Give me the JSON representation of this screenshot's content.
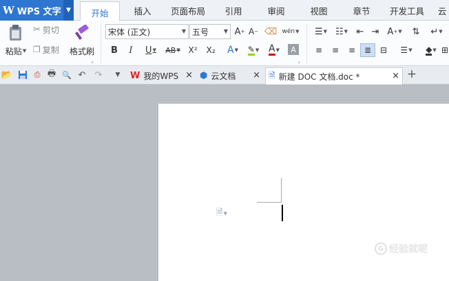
{
  "app": {
    "name": "WPS 文字",
    "logo": "W"
  },
  "menu_tabs": [
    "开始",
    "插入",
    "页面布局",
    "引用",
    "审阅",
    "视图",
    "章节",
    "开发工具",
    "云"
  ],
  "active_tab": "开始",
  "ribbon": {
    "paste_label": "粘贴",
    "cut_label": "剪切",
    "copy_label": "复制",
    "format_painter_label": "格式刷",
    "font_name": "宋体 (正文)",
    "font_size": "五号",
    "bold": "B",
    "italic": "I",
    "underline": "U",
    "strike": "AB",
    "superscript": "X²",
    "subscript": "X₂",
    "font_color_letter": "A",
    "pinyin": "wén"
  },
  "doc_tabs": [
    {
      "label": "我的WPS"
    },
    {
      "label": "云文档"
    },
    {
      "label": "新建 DOC 文档.doc *"
    }
  ],
  "watermark": {
    "text": "经验就呢",
    "mark": "G"
  },
  "colors": {
    "accent": "#2e76d0",
    "highlight": "#8fd400",
    "font_red": "#d00000"
  }
}
